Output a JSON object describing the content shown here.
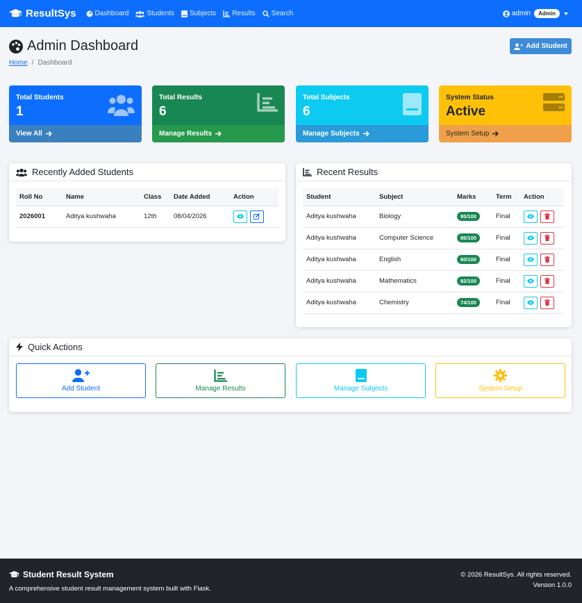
{
  "navbar": {
    "brand": "ResultSys",
    "items": [
      {
        "label": "Dashboard",
        "icon": "gauge-icon"
      },
      {
        "label": "Students",
        "icon": "users-icon"
      },
      {
        "label": "Subjects",
        "icon": "book-icon"
      },
      {
        "label": "Results",
        "icon": "chart-icon"
      },
      {
        "label": "Search",
        "icon": "search-icon"
      }
    ],
    "user": "admin",
    "role_badge": "Admin"
  },
  "header": {
    "title": "Admin Dashboard",
    "add_student_label": "Add Student",
    "breadcrumb": {
      "home": "Home",
      "current": "Dashboard"
    }
  },
  "stats": [
    {
      "label": "Total Students",
      "value": "1",
      "link": "View All",
      "color": "#0d6efd",
      "footer_color": "#3a80bf"
    },
    {
      "label": "Total Results",
      "value": "6",
      "link": "Manage Results",
      "color": "#198754",
      "footer_color": "#26994c"
    },
    {
      "label": "Total Subjects",
      "value": "6",
      "link": "Manage Subjects",
      "color": "#0dcaf0",
      "footer_color": "#2a9ad8"
    },
    {
      "label": "System Status",
      "value": "Active",
      "link": "System Setup",
      "color": "#ffc107",
      "footer_color": "#f0a04b"
    }
  ],
  "recent_students": {
    "title": "Recently Added Students",
    "columns": [
      "Roll No",
      "Name",
      "Class",
      "Date Added",
      "Action"
    ],
    "rows": [
      {
        "roll": "2026001",
        "name": "Aditya kushwaha",
        "class": "12th",
        "date": "08/04/2026"
      }
    ]
  },
  "recent_results": {
    "title": "Recent Results",
    "columns": [
      "Student",
      "Subject",
      "Marks",
      "Term",
      "Action"
    ],
    "rows": [
      {
        "student": "Aditya kushwaha",
        "subject": "Biology",
        "marks": "95/100",
        "term": "Final"
      },
      {
        "student": "Aditya kushwaha",
        "subject": "Computer Science",
        "marks": "86/100",
        "term": "Final"
      },
      {
        "student": "Aditya kushwaha",
        "subject": "English",
        "marks": "80/100",
        "term": "Final"
      },
      {
        "student": "Aditya kushwaha",
        "subject": "Mathematics",
        "marks": "82/100",
        "term": "Final"
      },
      {
        "student": "Aditya kushwaha",
        "subject": "Chemistry",
        "marks": "74/100",
        "term": "Final"
      }
    ]
  },
  "quick_actions": {
    "title": "Quick Actions",
    "items": [
      {
        "label": "Add Student",
        "color": "#0d6efd"
      },
      {
        "label": "Manage Results",
        "color": "#198754"
      },
      {
        "label": "Manage Subjects",
        "color": "#0dcaf0"
      },
      {
        "label": "System Setup",
        "color": "#ffc107"
      }
    ]
  },
  "footer": {
    "title": "Student Result System",
    "description": "A comprehensive student result management system built with Flask.",
    "copyright": "© 2026 ResultSys. All rights reserved.",
    "version": "Version 1.0.0"
  }
}
